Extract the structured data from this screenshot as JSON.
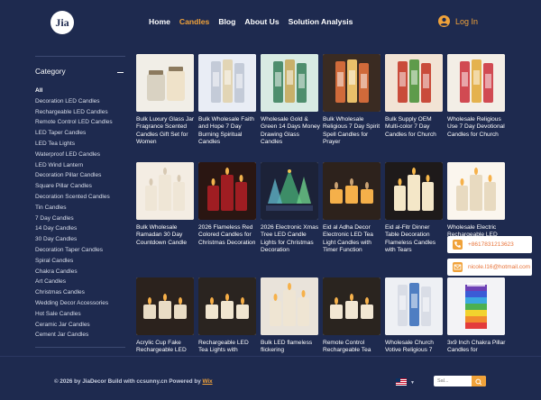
{
  "brand": {
    "logo_text": "Jia"
  },
  "nav": {
    "items": [
      "Home",
      "Candles",
      "Blog",
      "About Us",
      "Solution Analysis"
    ],
    "active": "Candles",
    "login_label": "Log In"
  },
  "sidebar": {
    "heading": "Category",
    "items": [
      "All",
      "Decoration LED Candles",
      "Rechargeable LED Candles",
      "Remote Control LED Candles",
      "LED Taper Candles",
      "LED Tea Lights",
      "Waterproof LED Candles",
      "LED Wind Lantern",
      "Decoration Pillar Candles",
      "Square Pillar Candles",
      "Decoration Scented Candles",
      "Tin Candles",
      "7 Day Candles",
      "14 Day Candles",
      "30 Day Candles",
      "Decoration Taper Candles",
      "Spiral Candles",
      "Chakra Candles",
      "Art Candles",
      "Christmas Candles",
      "Wedding Decor Accessories",
      "Hot Sale Candles",
      "Ceramic Jar Candles",
      "Cement Jar Candles"
    ]
  },
  "products": [
    {
      "title": "Bulk Luxury Glass Jar Fragrance Scented Candles Gift Set for Women",
      "icon": "jar-candle-icon"
    },
    {
      "title": "Bulk Wholesale Faith and Hope 7 Day Burning Spiritual Candles",
      "icon": "glass-candle-icon"
    },
    {
      "title": "Wholesale Gold & Green 14 Days Money Drawing Glass Candles",
      "icon": "glass-candle-icon"
    },
    {
      "title": "Bulk Wholesale Religious 7 Day Spirit Spell Candles for Prayer",
      "icon": "glass-candle-icon"
    },
    {
      "title": "Bulk Supply OEM Multi-color 7 Day Candles for Church",
      "icon": "glass-candle-icon"
    },
    {
      "title": "Wholesale Religious Use 7 Day Devotional Candles for Church",
      "icon": "glass-candle-icon"
    },
    {
      "title": "Bulk Wholesale Ramadan 30 Day Countdown Candle",
      "icon": "pillar-candle-icon"
    },
    {
      "title": "2026 Flameless Red Colored Candles for Christmas Decoration",
      "icon": "pillar-candle-icon"
    },
    {
      "title": "2026 Electronic Xmas Tree LED Candle Lights for Christmas Decoration",
      "icon": "tree-candle-icon"
    },
    {
      "title": "Eid al Adha Decor Electronic LED Tea Light Candles with Timer Function",
      "icon": "tealight-icon"
    },
    {
      "title": "Eid al-Fitr Dinner Table Decoration Flameless Candles with Tears",
      "icon": "pillar-candle-icon"
    },
    {
      "title": "Wholesale Electric Rechargeable LED Candle Decor",
      "icon": "pillar-candle-icon"
    },
    {
      "title": "Acrylic Cup Fake Rechargeable LED",
      "icon": "tealight-icon"
    },
    {
      "title": "Rechargeable LED Tea Lights with",
      "icon": "tealight-icon"
    },
    {
      "title": "Bulk LED flameless flickering",
      "icon": "pillar-candle-icon"
    },
    {
      "title": "Remote Control Rechargeable Tea",
      "icon": "tealight-icon"
    },
    {
      "title": "Wholesale Church Votive Religious 7",
      "icon": "glass-candle-icon"
    },
    {
      "title": "3x9 Inch Chakra Pillar Candles for",
      "icon": "chakra-candle-icon"
    }
  ],
  "contact": {
    "phone": "+8617831213623",
    "email": "nicole.l16@hotmail.com"
  },
  "footer": {
    "copyright_prefix": "© 2026 by JiaDecor Build with ccsunny.cn Powered by",
    "powered_link": "Wix",
    "search_placeholder": "Sal..."
  },
  "colors": {
    "background": "#1e2a4f",
    "accent": "#f0a23a",
    "text": "#ffffff"
  }
}
